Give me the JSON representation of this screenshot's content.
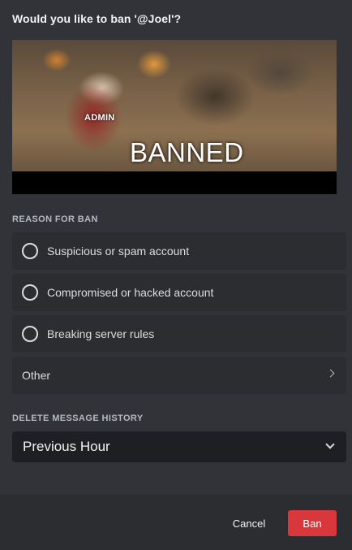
{
  "dialog": {
    "title": "Would you like to ban '@Joel'?"
  },
  "gif": {
    "caption_top": "ADMIN",
    "caption_main": "BANNED"
  },
  "reason": {
    "label": "REASON FOR BAN",
    "options": [
      {
        "label": "Suspicious or spam account"
      },
      {
        "label": "Compromised or hacked account"
      },
      {
        "label": "Breaking server rules"
      }
    ],
    "other_label": "Other"
  },
  "history": {
    "label": "DELETE MESSAGE HISTORY",
    "selected": "Previous Hour"
  },
  "footer": {
    "cancel_label": "Cancel",
    "ban_label": "Ban"
  },
  "colors": {
    "background": "#313338",
    "option_bg": "#2b2d31",
    "select_bg": "#1e1f22",
    "danger": "#da373c"
  },
  "icons": {
    "radio": "radio-empty-icon",
    "other": "chevron-right-icon",
    "select": "chevron-down-icon"
  }
}
